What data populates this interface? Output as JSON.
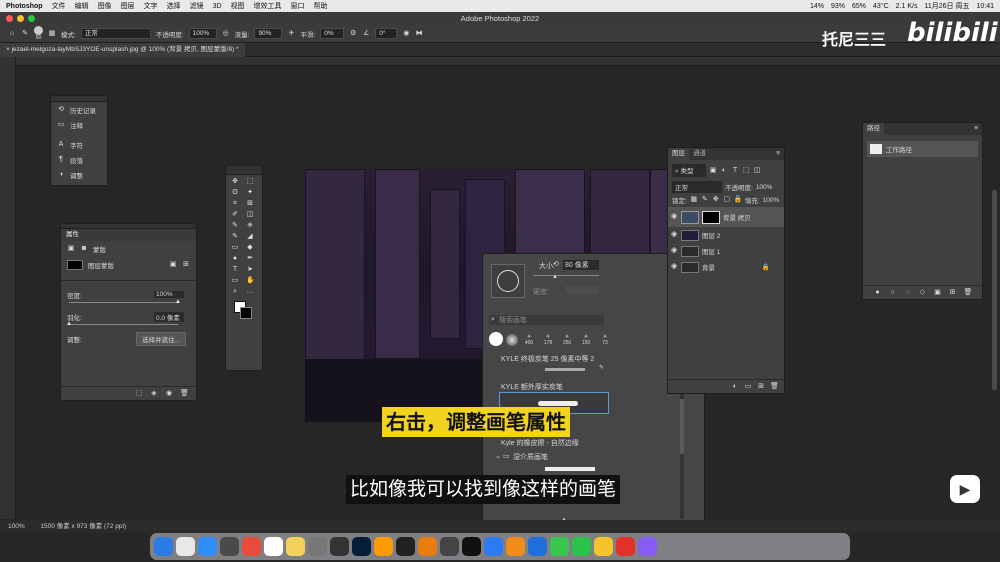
{
  "menubar": {
    "app": "Photoshop",
    "items": [
      "文件",
      "编辑",
      "图像",
      "图层",
      "文字",
      "选择",
      "滤镜",
      "3D",
      "视图",
      "增效工具",
      "窗口",
      "帮助"
    ],
    "status": [
      "14%",
      "93%",
      "65%",
      "43°C",
      "2.1 K/s",
      "11月26日 周五",
      "10:41"
    ]
  },
  "window": {
    "title": "Adobe Photoshop 2022"
  },
  "options": {
    "mode_label": "模式:",
    "mode_value": "正常",
    "opacity_label": "不透明度:",
    "opacity_value": "100%",
    "flow_label": "流量:",
    "flow_value": "90%",
    "smooth_label": "平滑:",
    "smooth_value": "0%",
    "angle_value": "0°",
    "brush_size": "60"
  },
  "doc_tab": {
    "label": "jezael-melgoza-layMbSJ3YOE-unsplash.jpg @ 100% (背景 拷贝, 图层蒙版/8) *"
  },
  "history_panel": {
    "items": [
      "历史记录",
      "注释",
      "字符",
      "段落",
      "调整"
    ]
  },
  "properties": {
    "title": "属性",
    "mask_label": "蒙版",
    "layer_mask": "图层蒙版",
    "density_label": "密度:",
    "density_value": "100%",
    "feather_label": "羽化:",
    "feather_value": "0.0 像素",
    "adjust_label": "调整:",
    "select_btn": "选择并遮住..."
  },
  "layers": {
    "tabs": [
      "图层",
      "通道"
    ],
    "filter_value": "类型",
    "blend_value": "正常",
    "opacity_label": "不透明度:",
    "opacity_value": "100%",
    "lock_label": "锁定:",
    "fill_label": "填充:",
    "fill_value": "100%",
    "rows": [
      "背景 拷贝",
      "图层 2",
      "图层 1",
      "背景"
    ]
  },
  "paths": {
    "title": "路径",
    "item": "工作路径"
  },
  "brush_picker": {
    "size_label": "大小:",
    "size_value": "80 像素",
    "hardness_label": "硬度:",
    "search_placeholder": "搜索画笔",
    "presets": [
      "400",
      "178",
      "250",
      "150",
      "73"
    ],
    "brushes": [
      "KYLE 终极炭笔 25 像素中等 2",
      "KYLE 额外厚实炭笔",
      "Kyle 的橡皮擦 - 自然边缘"
    ],
    "group": "湿介质画笔"
  },
  "status": {
    "zoom": "100%",
    "size": "1500 像素 x 973 像素 (72 ppi)"
  },
  "captions": {
    "line1": "右击，调整画笔属性",
    "line2": "比如像我可以找到像这样的画笔"
  },
  "watermark": {
    "name": "托尼三三",
    "logo": "bilibili"
  },
  "dock": [
    "Finder",
    "Launchpad",
    "Safari",
    "Preview",
    "Chrome",
    "Calendar",
    "Notes",
    "Settings",
    "Pen",
    "Ps",
    "Ai",
    "Final Cut",
    "Blender",
    "OBS",
    "Capcut",
    "Mail",
    "Pages",
    "Drive",
    "Messages",
    "WeChat",
    "Edit",
    "Weibo",
    "Box"
  ],
  "colors": {
    "caption_bg": "#f2d31d",
    "accent": "#1473e6"
  }
}
